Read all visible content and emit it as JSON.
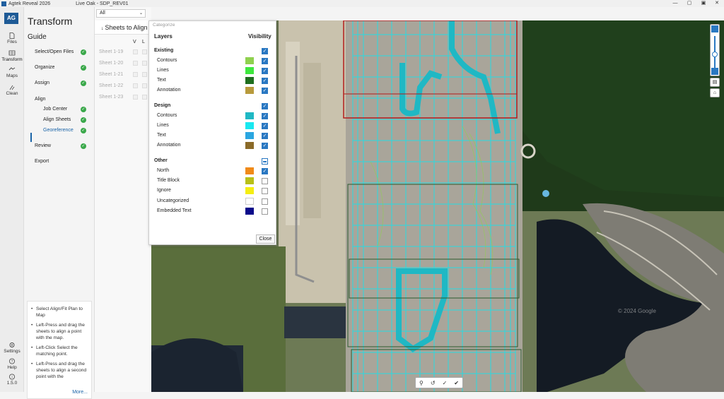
{
  "titlebar": {
    "app_name": "Agtek Reveal 2026",
    "project": "Live Oak - SDP_REV01",
    "controls": [
      "—",
      "▢",
      "▣",
      "✕"
    ]
  },
  "rail": {
    "logo": "AG",
    "items": [
      {
        "label": "Files",
        "icon": "files-icon"
      },
      {
        "label": "Transform",
        "icon": "transform-icon"
      },
      {
        "label": "Maps",
        "icon": "maps-icon"
      },
      {
        "label": "Clean",
        "icon": "clean-icon"
      }
    ],
    "bottom": [
      {
        "label": "Settings",
        "icon": "gear-icon"
      },
      {
        "label": "Help",
        "icon": "help-icon"
      },
      {
        "label": "1.5.0",
        "icon": "info-icon"
      }
    ]
  },
  "guide": {
    "title": "Transform",
    "subtitle": "Guide",
    "steps": [
      {
        "label": "Select/Open Files",
        "done": true
      },
      {
        "label": "Organize",
        "done": true
      },
      {
        "label": "Assign",
        "done": true
      },
      {
        "label": "Align",
        "done": false
      },
      {
        "label": "Job Center",
        "done": true
      },
      {
        "label": "Align Sheets",
        "done": true
      },
      {
        "label": "Georeference",
        "done": true
      },
      {
        "label": "Review",
        "done": true
      },
      {
        "label": "Export",
        "done": false
      }
    ],
    "tips": [
      "Select Align/Fit Plan to Map",
      "Left-Press and drag the sheets to align a point with the map.",
      "Left-Click Select the matching point.",
      "Left-Press and drag the sheets to align a second point with the"
    ],
    "more": "More..."
  },
  "sheets": {
    "filter": "All",
    "header": "Sheets to Align",
    "col_v": "V",
    "col_l": "L",
    "rows": [
      "Sheet 1-19",
      "Sheet 1-20",
      "Sheet 1-21",
      "Sheet 1-22",
      "Sheet 1-23"
    ]
  },
  "categorize": {
    "title": "Categorize",
    "col_layers": "Layers",
    "col_visibility": "Visibility",
    "groups": [
      {
        "name": "Existing",
        "state": "on",
        "layers": [
          {
            "name": "Contours",
            "color": "#8fd14f",
            "visible": true
          },
          {
            "name": "Lines",
            "color": "#3ee83e",
            "visible": true
          },
          {
            "name": "Text",
            "color": "#1e6e1e",
            "visible": true
          },
          {
            "name": "Annotation",
            "color": "#b89a3c",
            "visible": true
          }
        ]
      },
      {
        "name": "Design",
        "state": "on",
        "layers": [
          {
            "name": "Contours",
            "color": "#1fb8c4",
            "visible": true
          },
          {
            "name": "Lines",
            "color": "#19e8f0",
            "visible": true
          },
          {
            "name": "Text",
            "color": "#2aa6e0",
            "visible": true
          },
          {
            "name": "Annotation",
            "color": "#8a6a28",
            "visible": true
          }
        ]
      },
      {
        "name": "Other",
        "state": "partial",
        "layers": [
          {
            "name": "North",
            "color": "#f08a18",
            "visible": true
          },
          {
            "name": "Title Block",
            "color": "#b8c018",
            "visible": false
          },
          {
            "name": "Ignore",
            "color": "#f5ee12",
            "visible": false
          },
          {
            "name": "Uncategorized",
            "color": "#ffffff",
            "visible": false
          },
          {
            "name": "Embedded Text",
            "color": "#0a0a8a",
            "visible": false
          }
        ]
      }
    ],
    "close": "Close"
  },
  "map": {
    "watermark": "© 2024 Google"
  },
  "colors": {
    "accent": "#1a64a8",
    "check": "#3aa84a",
    "overlay_design": "#19e0ea",
    "sheet_frame": "#b41c1c"
  }
}
